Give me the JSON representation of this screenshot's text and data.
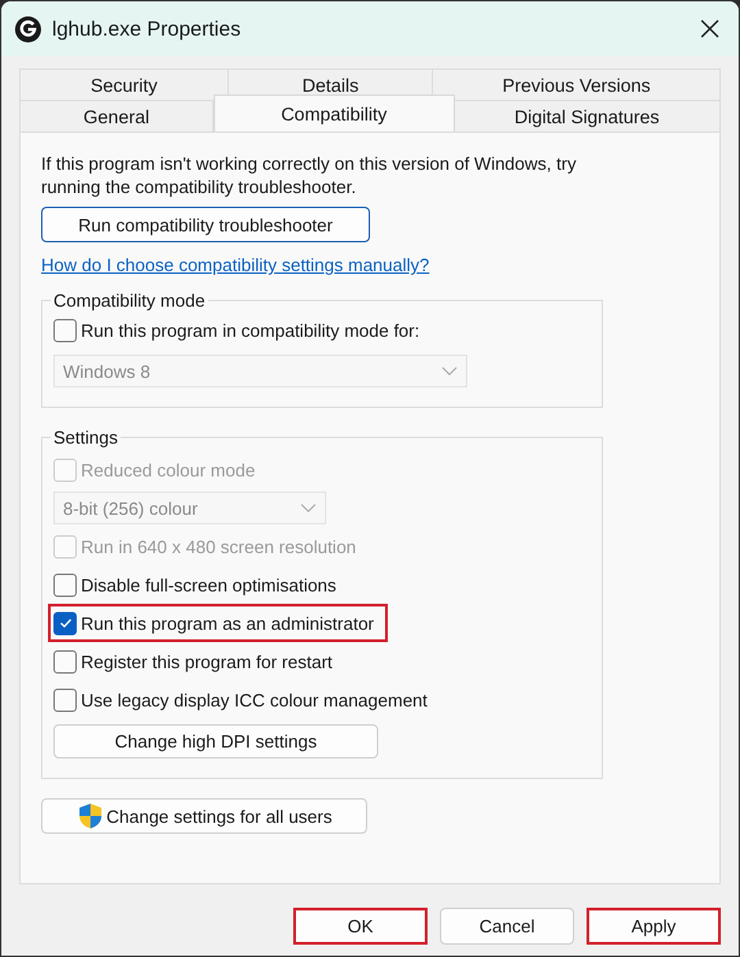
{
  "window": {
    "title": "lghub.exe Properties"
  },
  "tab_rows": [
    [
      {
        "label": "Security",
        "selected": false
      },
      {
        "label": "Details",
        "selected": false
      },
      {
        "label": "Previous Versions",
        "selected": false
      }
    ],
    [
      {
        "label": "General",
        "selected": false
      },
      {
        "label": "Compatibility",
        "selected": true
      },
      {
        "label": "Digital Signatures",
        "selected": false
      }
    ]
  ],
  "intro": "If this program isn't working correctly on this version of Windows, try running the compatibility troubleshooter.",
  "troubleshooter_button": "Run compatibility troubleshooter",
  "help_link": "How do I choose compatibility settings manually?",
  "compatibility_mode": {
    "legend": "Compatibility mode",
    "items": [
      {
        "kind": "checkbox",
        "label": "Run this program in compatibility mode for:",
        "checked": false,
        "disabled": false,
        "highlighted": false
      },
      {
        "kind": "dropdown",
        "value": "Windows 8",
        "disabled": true
      }
    ]
  },
  "settings": {
    "legend": "Settings",
    "items": [
      {
        "kind": "checkbox",
        "label": "Reduced colour mode",
        "checked": false,
        "disabled": true,
        "highlighted": false
      },
      {
        "kind": "dropdown",
        "value": "8-bit (256) colour",
        "disabled": true
      },
      {
        "kind": "checkbox",
        "label": "Run in 640 x 480 screen resolution",
        "checked": false,
        "disabled": true,
        "highlighted": false
      },
      {
        "kind": "checkbox",
        "label": "Disable full-screen optimisations",
        "checked": false,
        "disabled": false,
        "highlighted": false
      },
      {
        "kind": "checkbox",
        "label": "Run this program as an administrator",
        "checked": true,
        "disabled": false,
        "highlighted": true
      },
      {
        "kind": "checkbox",
        "label": "Register this program for restart",
        "checked": false,
        "disabled": false,
        "highlighted": false
      },
      {
        "kind": "checkbox",
        "label": "Use legacy display ICC colour management",
        "checked": false,
        "disabled": false,
        "highlighted": false
      },
      {
        "kind": "button",
        "label": "Change high DPI settings"
      }
    ]
  },
  "all_users_button": "Change settings for all users",
  "buttons": [
    {
      "label": "OK",
      "highlighted": true
    },
    {
      "label": "Cancel",
      "highlighted": false
    },
    {
      "label": "Apply",
      "highlighted": true
    }
  ]
}
